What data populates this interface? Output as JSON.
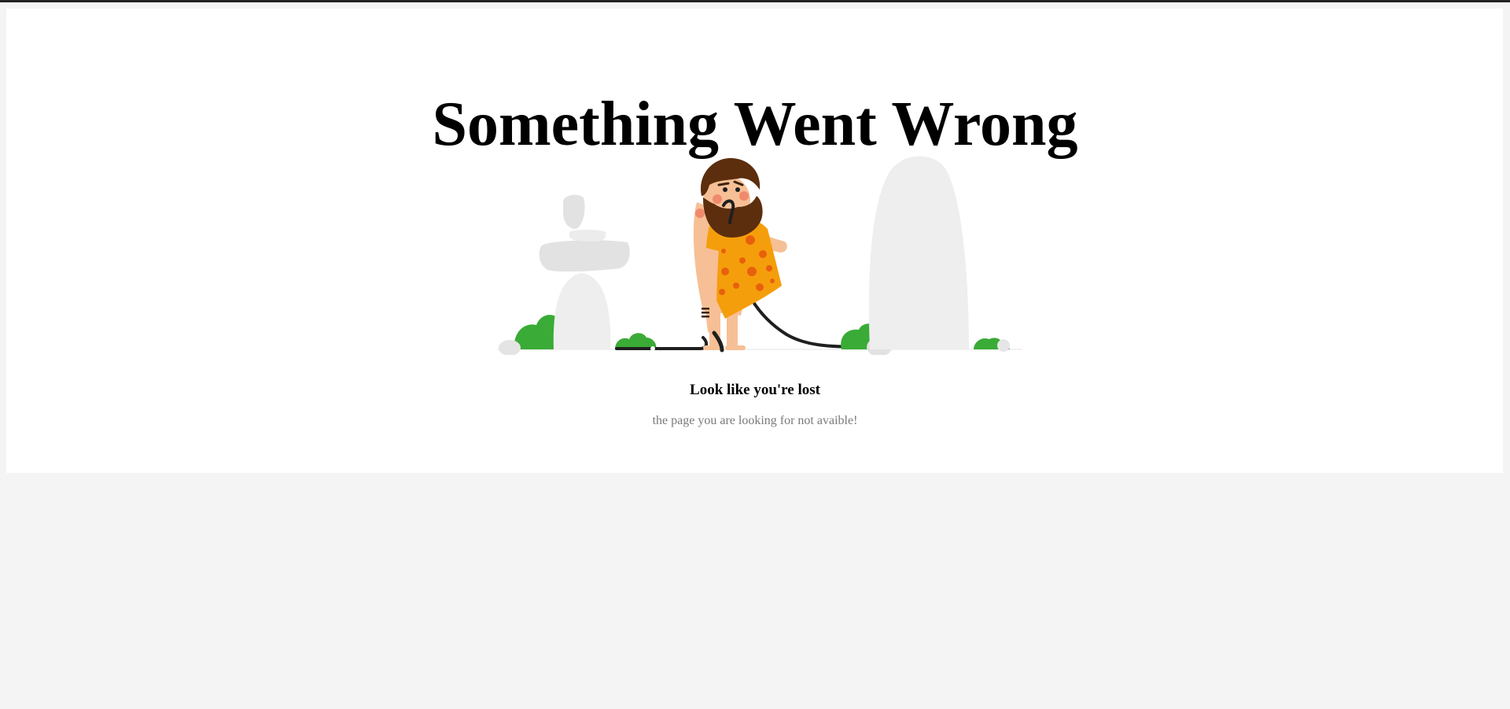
{
  "page": {
    "heading": "Something Went Wrong",
    "subheading": "Look like you're lost",
    "message": "the page you are looking for not avaible!"
  },
  "illustration": {
    "subject": "caveman-holding-cable-illustration",
    "colors": {
      "rock": "#eeeeee",
      "rock_dark": "#e0e0e0",
      "bush": "#3aab36",
      "skin": "#f7bf95",
      "beard": "#5c2e0e",
      "cloth": "#f59e0b",
      "spots": "#e8600c",
      "cable": "#1f1f1f"
    }
  },
  "colors": {
    "page_background": "#f4f4f4",
    "card_background": "#ffffff",
    "heading": "#000000",
    "message": "#7a7a7a"
  }
}
